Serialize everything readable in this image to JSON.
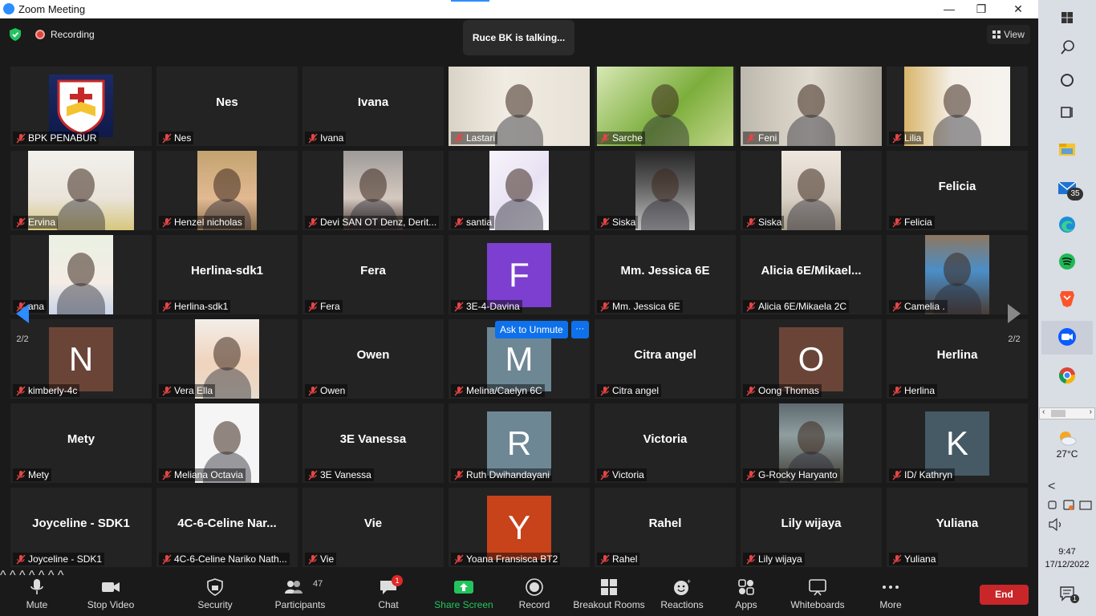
{
  "window": {
    "title": "Zoom Meeting",
    "minimize": "—",
    "maximize": "❐",
    "close": "✕"
  },
  "header": {
    "recording": "Recording",
    "talking": "Ruce BK is talking...",
    "view": "View"
  },
  "pager": {
    "left_label": "2/2",
    "right_label": "2/2"
  },
  "unmute": {
    "label": "Ask to Unmute",
    "more": "···"
  },
  "tiles": [
    {
      "name": "BPK PENABUR",
      "big": "",
      "kind": "logo"
    },
    {
      "name": "Nes",
      "big": "Nes",
      "kind": "text"
    },
    {
      "name": "Ivana",
      "big": "Ivana",
      "kind": "text"
    },
    {
      "name": "Lastari",
      "big": "",
      "kind": "video"
    },
    {
      "name": "Sarche",
      "big": "",
      "kind": "video"
    },
    {
      "name": "Feni",
      "big": "",
      "kind": "video"
    },
    {
      "name": "Lilia",
      "big": "",
      "kind": "video"
    },
    {
      "name": "Ervina",
      "big": "",
      "kind": "video"
    },
    {
      "name": "Henzel nicholas",
      "big": "",
      "kind": "video"
    },
    {
      "name": "Devi SAN OT Denz, Derit...",
      "big": "",
      "kind": "video"
    },
    {
      "name": "santia",
      "big": "",
      "kind": "video"
    },
    {
      "name": "Siska",
      "big": "",
      "kind": "video"
    },
    {
      "name": "Siska",
      "big": "",
      "kind": "video"
    },
    {
      "name": "Felicia",
      "big": "Felicia",
      "kind": "text"
    },
    {
      "name": "ana",
      "big": "",
      "kind": "video"
    },
    {
      "name": "Herlina-sdk1",
      "big": "Herlina-sdk1",
      "kind": "text"
    },
    {
      "name": "Fera",
      "big": "Fera",
      "kind": "text"
    },
    {
      "name": "3E-4-Davina",
      "big": "F",
      "kind": "avatar",
      "color": "#7c3fd0"
    },
    {
      "name": "Mm. Jessica 6E",
      "big": "Mm. Jessica 6E",
      "kind": "text"
    },
    {
      "name": "Alicia 6E/Mikaela 2C",
      "big": "Alicia  6E/Mikael...",
      "kind": "text"
    },
    {
      "name": "Camelia .",
      "big": "",
      "kind": "video"
    },
    {
      "name": "kimberly-4c",
      "big": "N",
      "kind": "avatar",
      "color": "#6b4438"
    },
    {
      "name": "Vera Ella",
      "big": "",
      "kind": "video"
    },
    {
      "name": "Owen",
      "big": "Owen",
      "kind": "text"
    },
    {
      "name": "Melina/Caelyn 6C",
      "big": "M",
      "kind": "avatar",
      "color": "#6e8795"
    },
    {
      "name": "Citra angel",
      "big": "Citra angel",
      "kind": "text"
    },
    {
      "name": "Oong Thomas",
      "big": "O",
      "kind": "avatar",
      "color": "#6b4438"
    },
    {
      "name": "Herlina",
      "big": "Herlina",
      "kind": "text"
    },
    {
      "name": "Mety",
      "big": "Mety",
      "kind": "text"
    },
    {
      "name": "Meliana Octavia",
      "big": "",
      "kind": "video"
    },
    {
      "name": "3E Vanessa",
      "big": "3E Vanessa",
      "kind": "text"
    },
    {
      "name": "Ruth Dwihandayani",
      "big": "R",
      "kind": "avatar",
      "color": "#6e8795"
    },
    {
      "name": "Victoria",
      "big": "Victoria",
      "kind": "text"
    },
    {
      "name": "G-Rocky Haryanto",
      "big": "",
      "kind": "video"
    },
    {
      "name": "ID/ Kathryn",
      "big": "K",
      "kind": "avatar",
      "color": "#455a64"
    },
    {
      "name": "Joyceline - SDK1",
      "big": "Joyceline - SDK1",
      "kind": "text"
    },
    {
      "name": "4C-6-Celine Nariko Nath...",
      "big": "4C-6-Celine  Nar...",
      "kind": "text"
    },
    {
      "name": "Vie",
      "big": "Vie",
      "kind": "text"
    },
    {
      "name": "Yoana Fransisca BT2",
      "big": "Y",
      "kind": "avatar",
      "color": "#c8431a"
    },
    {
      "name": "Rahel",
      "big": "Rahel",
      "kind": "text"
    },
    {
      "name": "Lily wijaya",
      "big": "Lily wijaya",
      "kind": "text"
    },
    {
      "name": "Yuliana",
      "big": "Yuliana",
      "kind": "text"
    }
  ],
  "toolbar": {
    "mute": "Mute",
    "stop_video": "Stop Video",
    "security": "Security",
    "participants": "Participants",
    "participants_count": "47",
    "chat": "Chat",
    "chat_badge": "1",
    "share_screen": "Share Screen",
    "record": "Record",
    "breakout": "Breakout Rooms",
    "reactions": "Reactions",
    "apps": "Apps",
    "whiteboards": "Whiteboards",
    "more": "More",
    "end": "End",
    "caret": "^"
  },
  "taskbar": {
    "mail_badge": "35",
    "weather": "27°C",
    "time": "9:47",
    "date": "17/12/2022",
    "notif_badge": "1",
    "chevron": "<"
  },
  "colors": {
    "accent": "#0e71eb",
    "end": "#c9262a",
    "share": "#23c45e",
    "bg": "#1a1a1a"
  }
}
